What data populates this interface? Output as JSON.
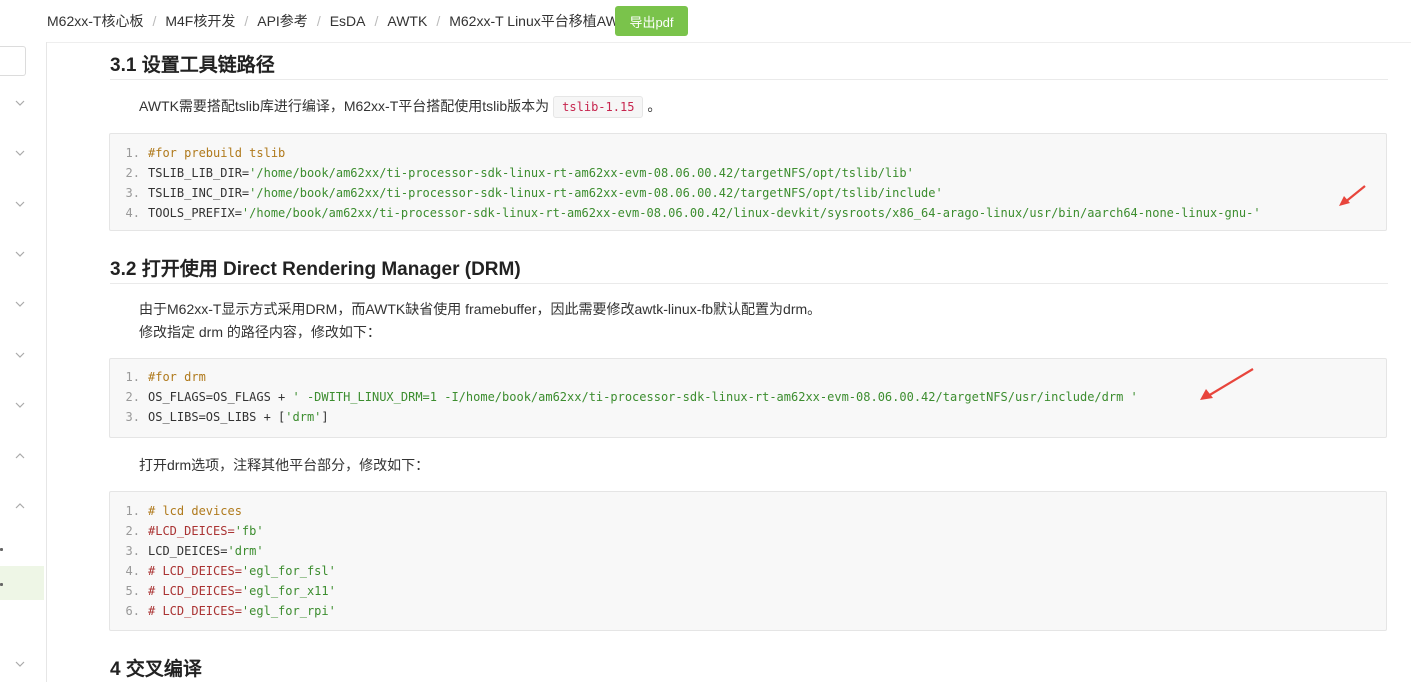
{
  "breadcrumb": [
    "M62xx-T核心板",
    "M4F核开发",
    "API参考",
    "EsDA",
    "AWTK",
    "M62xx-T Linux平台移植AWTK"
  ],
  "export_button": "导出pdf",
  "section_31": {
    "title": "3.1 设置工具链路径",
    "text_before": "AWTK需要搭配tslib库进行编译，M62xx-T平台搭配使用tslib版本为",
    "inline_code": "tslib-1.15",
    "text_after": "。",
    "code": [
      {
        "n": "1.",
        "parts": [
          {
            "t": "#for prebuild tslib",
            "k": "cm"
          }
        ]
      },
      {
        "n": "2.",
        "parts": [
          {
            "t": "TSLIB_LIB_DIR=",
            "k": "pl"
          },
          {
            "t": "'/home/book/am62xx/ti-processor-sdk-linux-rt-am62xx-evm-08.06.00.42/targetNFS/opt/tslib/lib'",
            "k": "str"
          }
        ]
      },
      {
        "n": "3.",
        "parts": [
          {
            "t": "TSLIB_INC_DIR=",
            "k": "pl"
          },
          {
            "t": "'/home/book/am62xx/ti-processor-sdk-linux-rt-am62xx-evm-08.06.00.42/targetNFS/opt/tslib/include'",
            "k": "str"
          }
        ]
      },
      {
        "n": "4.",
        "parts": [
          {
            "t": "TOOLS_PREFIX=",
            "k": "pl"
          },
          {
            "t": "'/home/book/am62xx/ti-processor-sdk-linux-rt-am62xx-evm-08.06.00.42/linux-devkit/sysroots/x86_64-arago-linux/usr/bin/aarch64-none-linux-gnu-'",
            "k": "str"
          }
        ]
      }
    ]
  },
  "section_32": {
    "title": "3.2 打开使用 Direct Rendering Manager (DRM)",
    "para1": "由于M62xx-T显示方式采用DRM，而AWTK缺省使用 framebuffer，因此需要修改awtk-linux-fb默认配置为drm。",
    "para2": "修改指定 drm 的路径内容，修改如下：",
    "code": [
      {
        "n": "1.",
        "parts": [
          {
            "t": "#for drm",
            "k": "cm"
          }
        ]
      },
      {
        "n": "2.",
        "parts": [
          {
            "t": "OS_FLAGS=OS_FLAGS + ",
            "k": "pl"
          },
          {
            "t": "' -DWITH_LINUX_DRM=1 -I/home/book/am62xx/ti-processor-sdk-linux-rt-am62xx-evm-08.06.00.42/targetNFS/usr/include/drm '",
            "k": "str"
          }
        ]
      },
      {
        "n": "3.",
        "parts": [
          {
            "t": "OS_LIBS=OS_LIBS + [",
            "k": "pl"
          },
          {
            "t": "'drm'",
            "k": "str"
          },
          {
            "t": "]",
            "k": "pl"
          }
        ]
      }
    ],
    "para3": "打开drm选项，注释其他平台部分，修改如下：",
    "code2": [
      {
        "n": "1.",
        "parts": [
          {
            "t": "# lcd devices",
            "k": "cm"
          }
        ]
      },
      {
        "n": "2.",
        "parts": [
          {
            "t": "#LCD_DEICES=",
            "k": "cmr"
          },
          {
            "t": "'fb'",
            "k": "str"
          }
        ]
      },
      {
        "n": "3.",
        "parts": [
          {
            "t": "LCD_DEICES=",
            "k": "pl"
          },
          {
            "t": "'drm'",
            "k": "str"
          }
        ]
      },
      {
        "n": "4.",
        "parts": [
          {
            "t": "# LCD_DEICES=",
            "k": "cmr"
          },
          {
            "t": "'egl_for_fsl'",
            "k": "str"
          }
        ]
      },
      {
        "n": "5.",
        "parts": [
          {
            "t": "# LCD_DEICES=",
            "k": "cmr"
          },
          {
            "t": "'egl_for_x11'",
            "k": "str"
          }
        ]
      },
      {
        "n": "6.",
        "parts": [
          {
            "t": "# LCD_DEICES=",
            "k": "cmr"
          },
          {
            "t": "'egl_for_rpi'",
            "k": "str"
          }
        ]
      }
    ]
  },
  "section_4": {
    "title": "4 交叉编译"
  },
  "colors": {
    "accent": "#7ac34b",
    "arrow": "#e8453c",
    "inline_code": "#c7254e"
  },
  "icons": {
    "sidebar_chevron": "chevron-icon",
    "annotation": "red-arrow-icon"
  }
}
